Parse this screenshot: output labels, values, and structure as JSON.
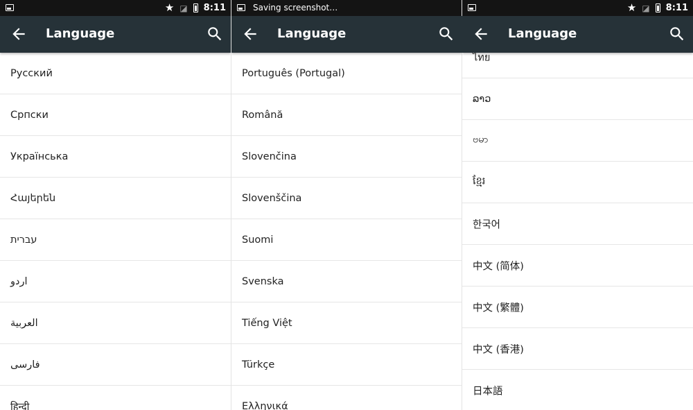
{
  "panels": [
    {
      "status": {
        "notification": "",
        "time": "8:11"
      },
      "title": "Language",
      "items": [
        "Русский",
        "Српски",
        "Українська",
        "Հայերեն",
        "עברית",
        "اردو",
        "العربية",
        "فارسی",
        "हिन्दी"
      ]
    },
    {
      "status": {
        "notification": "Saving screenshot…",
        "time": ""
      },
      "title": "Language",
      "items": [
        "Português (Portugal)",
        "Română",
        "Slovenčina",
        "Slovenščina",
        "Suomi",
        "Svenska",
        "Tiếng Việt",
        "Türkçe",
        "Ελληνικά"
      ]
    },
    {
      "status": {
        "notification": "",
        "time": "8:11"
      },
      "title": "Language",
      "items": [
        "ไทย",
        "ລາວ",
        "ဗမာ",
        "ខ្មែរ",
        "한국어",
        "中文 (简体)",
        "中文 (繁體)",
        "中文 (香港)",
        "日本語"
      ]
    }
  ],
  "icons": {
    "status_screenshot": "image-icon",
    "status_star": "star-icon",
    "status_signal": "no-signal-icon",
    "status_battery": "battery-icon",
    "back": "arrow-back-icon",
    "search": "search-icon"
  },
  "colors": {
    "status_bar": "#141414",
    "app_bar": "#263238",
    "list_background": "#ffffff",
    "divider": "#e6e6e6",
    "text": "#222222"
  }
}
